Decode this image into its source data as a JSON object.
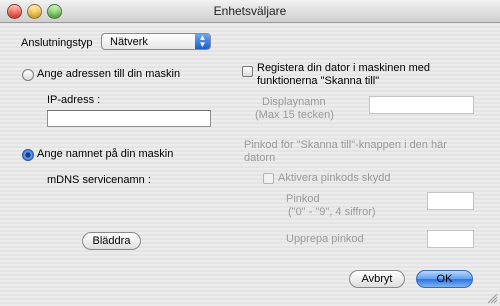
{
  "window": {
    "title": "Enhetsväljare"
  },
  "connection": {
    "label": "Anslutningstyp",
    "value": "Nätverk"
  },
  "left": {
    "radio_address_label": "Ange adressen till din maskin",
    "ip_label": "IP-adress :",
    "ip_value": "",
    "radio_name_label": "Ange namnet på din maskin",
    "mdns_label": "mDNS servicenamn :",
    "browse_button": "Bläddra"
  },
  "right": {
    "register_line1": "Registera din dator i maskinen med",
    "register_line2": "funktionerna \"Skanna till\"",
    "display_name_label": "Displaynamn",
    "display_name_hint": "(Max 15 tecken)",
    "pin_heading_line1": "Pinkod för \"Skanna  till\"-knappen i den här",
    "pin_heading_line2": "datorn",
    "activate_pin_label": "Aktivera pinkods skydd",
    "pin_label": "Pinkod",
    "pin_hint": "(\"0\" - \"9\", 4 siffror)",
    "repeat_pin_label": "Upprepa pinkod"
  },
  "footer": {
    "cancel_button": "Avbryt",
    "ok_button": "OK"
  },
  "state": {
    "selected_radio": "name",
    "register_checked": false,
    "activate_pin_checked": false
  }
}
